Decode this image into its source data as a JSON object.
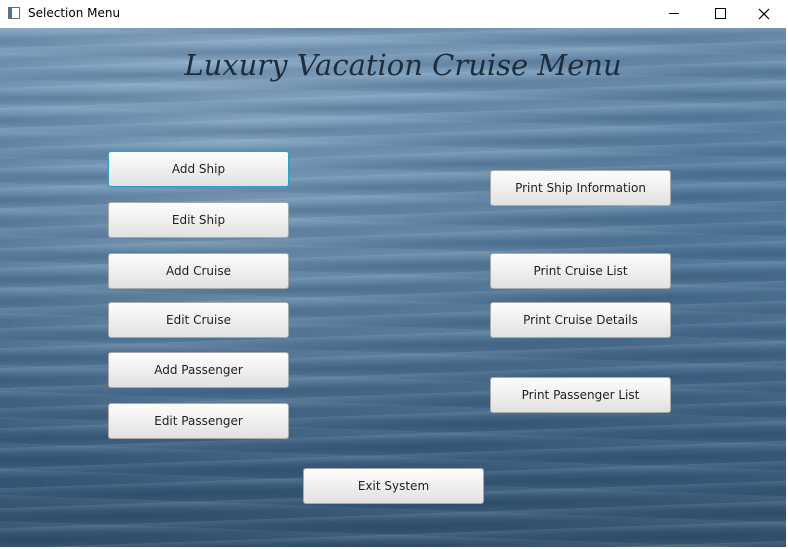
{
  "window": {
    "title": "Selection Menu",
    "controls": {
      "minimize_icon": "minimize-icon",
      "maximize_icon": "maximize-icon",
      "close_icon": "close-icon"
    }
  },
  "menu": {
    "heading": "Luxury Vacation Cruise Menu",
    "left_buttons": {
      "add_ship": "Add Ship",
      "edit_ship": "Edit Ship",
      "add_cruise": "Add Cruise",
      "edit_cruise": "Edit Cruise",
      "add_passenger": "Add Passenger",
      "edit_passenger": "Edit Passenger"
    },
    "right_buttons": {
      "print_ship_information": "Print Ship Information",
      "print_cruise_list": "Print Cruise List",
      "print_cruise_details": "Print Cruise Details",
      "print_passenger_list": "Print Passenger List"
    },
    "exit_button": "Exit System",
    "focused_button": "Add Ship"
  },
  "colors": {
    "focus_ring": "#2aa3c4",
    "heading_text": "#1e2c3c",
    "water": "#4b7092"
  }
}
